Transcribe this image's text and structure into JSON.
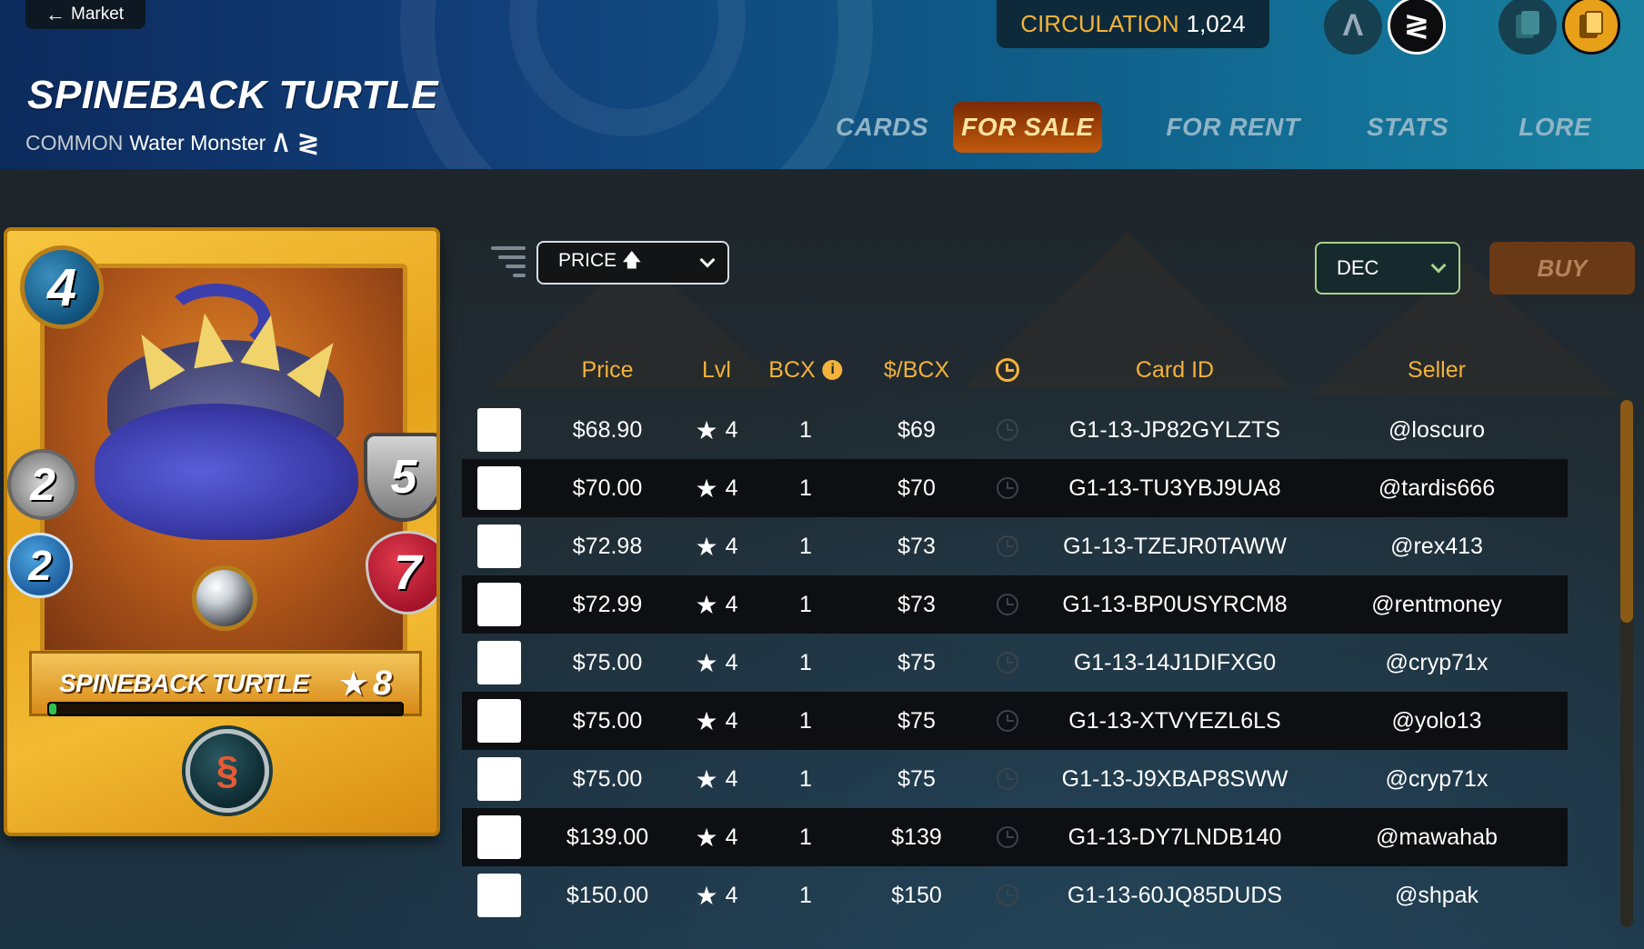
{
  "nav": {
    "back_label": "Market"
  },
  "card": {
    "name": "SPINEBACK TURTLE",
    "rarity": "COMMON",
    "type": "Water Monster",
    "edition_icons": [
      "alpha-edition-icon",
      "beta-edition-icon"
    ],
    "art_name": "SPINEBACK TURTLE",
    "level": "8",
    "mana": "4",
    "melee": "2",
    "speed": "2",
    "armor": "5",
    "health": "7",
    "xp_progress": 0.02
  },
  "circulation": {
    "label": "CIRCULATION",
    "value": "1,024"
  },
  "tabs": [
    {
      "label": "CARDS",
      "active": false
    },
    {
      "label": "FOR SALE",
      "active": true
    },
    {
      "label": "FOR RENT",
      "active": false
    },
    {
      "label": "STATS",
      "active": false
    },
    {
      "label": "LORE",
      "active": false
    }
  ],
  "toolbar": {
    "sort_label": "PRICE",
    "currency": "DEC",
    "buy_label": "BUY"
  },
  "table": {
    "headers": {
      "price": "Price",
      "lvl": "Lvl",
      "bcx": "BCX",
      "per_bcx": "$/BCX",
      "card_id": "Card ID",
      "seller": "Seller"
    },
    "rows": [
      {
        "price": "$68.90",
        "lvl": "4",
        "bcx": "1",
        "per_bcx": "$69",
        "card_id": "G1-13-JP82GYLZTS",
        "seller": "@loscuro"
      },
      {
        "price": "$70.00",
        "lvl": "4",
        "bcx": "1",
        "per_bcx": "$70",
        "card_id": "G1-13-TU3YBJ9UA8",
        "seller": "@tardis666"
      },
      {
        "price": "$72.98",
        "lvl": "4",
        "bcx": "1",
        "per_bcx": "$73",
        "card_id": "G1-13-TZEJR0TAWW",
        "seller": "@rex413"
      },
      {
        "price": "$72.99",
        "lvl": "4",
        "bcx": "1",
        "per_bcx": "$73",
        "card_id": "G1-13-BP0USYRCM8",
        "seller": "@rentmoney"
      },
      {
        "price": "$75.00",
        "lvl": "4",
        "bcx": "1",
        "per_bcx": "$75",
        "card_id": "G1-13-14J1DIFXG0",
        "seller": "@cryp71x"
      },
      {
        "price": "$75.00",
        "lvl": "4",
        "bcx": "1",
        "per_bcx": "$75",
        "card_id": "G1-13-XTVYEZL6LS",
        "seller": "@yolo13"
      },
      {
        "price": "$75.00",
        "lvl": "4",
        "bcx": "1",
        "per_bcx": "$75",
        "card_id": "G1-13-J9XBAP8SWW",
        "seller": "@cryp71x"
      },
      {
        "price": "$139.00",
        "lvl": "4",
        "bcx": "1",
        "per_bcx": "$139",
        "card_id": "G1-13-DY7LNDB140",
        "seller": "@mawahab"
      },
      {
        "price": "$150.00",
        "lvl": "4",
        "bcx": "1",
        "per_bcx": "$150",
        "card_id": "G1-13-60JQ85DUDS",
        "seller": "@shpak"
      }
    ]
  },
  "colors": {
    "accent_gold": "#f3b23b",
    "active_tab": "#c05a0c",
    "buy_button": "#6a3a17",
    "currency_border": "#a8d38c"
  }
}
